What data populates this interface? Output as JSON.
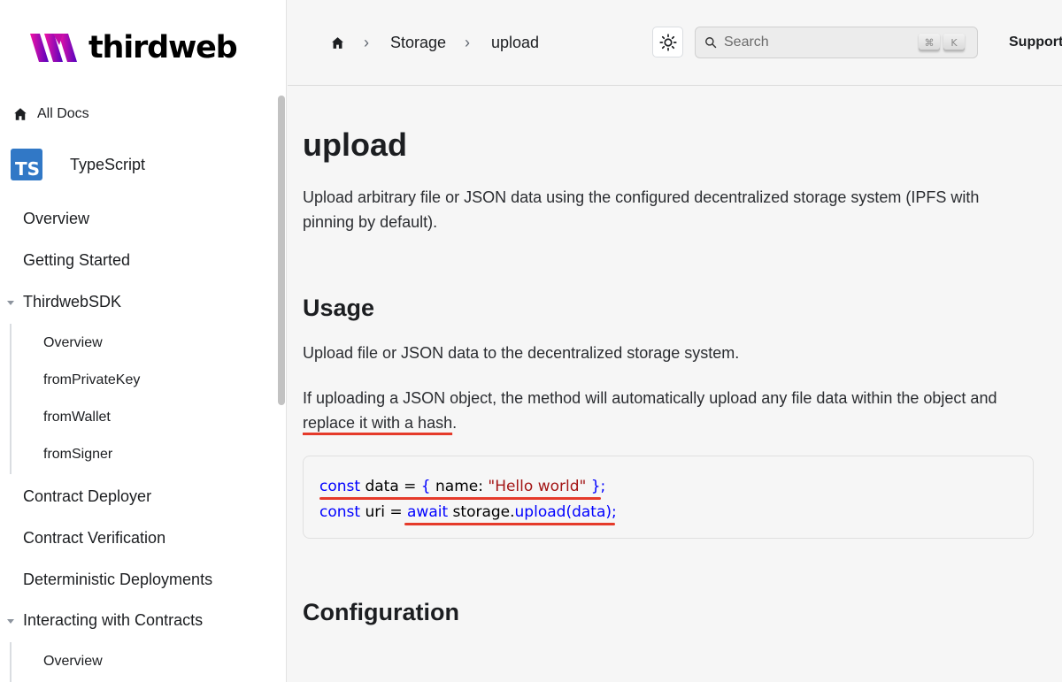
{
  "brand": {
    "name": "thirdweb"
  },
  "sidebar": {
    "all_docs": "All Docs",
    "typescript": {
      "badge": "TS",
      "label": "TypeScript"
    },
    "items": [
      {
        "label": "Overview"
      },
      {
        "label": "Getting Started"
      },
      {
        "label": "ThirdwebSDK",
        "expanded": true,
        "children": [
          "Overview",
          "fromPrivateKey",
          "fromWallet",
          "fromSigner"
        ]
      },
      {
        "label": "Contract Deployer"
      },
      {
        "label": "Contract Verification"
      },
      {
        "label": "Deterministic Deployments"
      },
      {
        "label": "Interacting with Contracts",
        "expanded": true,
        "children": [
          "Overview"
        ]
      }
    ]
  },
  "header": {
    "breadcrumbs": [
      "Storage",
      "upload"
    ],
    "search_placeholder": "Search",
    "shortcut_keys": [
      "⌘",
      "K"
    ],
    "support": "Support"
  },
  "page": {
    "title": "upload",
    "intro": "Upload arbitrary file or JSON data using the configured decentralized storage system (IPFS with pinning by default).",
    "usage_heading": "Usage",
    "usage_p1": "Upload file or JSON data to the decentralized storage system.",
    "usage_p2_a": "If uploading a JSON object, the method will automatically upload any file data within the object and ",
    "usage_p2_b": "replace it with a hash",
    "usage_p2_c": ".",
    "code": {
      "line1": {
        "kw": "const",
        "rest1": " data = ",
        "brace_open": "{",
        "mid": " name: ",
        "str": "\"Hello world\"",
        "end": " };"
      },
      "line2": {
        "kw": "const",
        "rest1": " uri = ",
        "await": "await",
        "obj": " storage.",
        "fn": "upload",
        "args": "(data);"
      }
    },
    "config_heading": "Configuration"
  },
  "colors": {
    "accent_underline": "#e53a2a",
    "keyword": "#0000ff",
    "string": "#a31515",
    "ts_badge": "#3178c6"
  }
}
